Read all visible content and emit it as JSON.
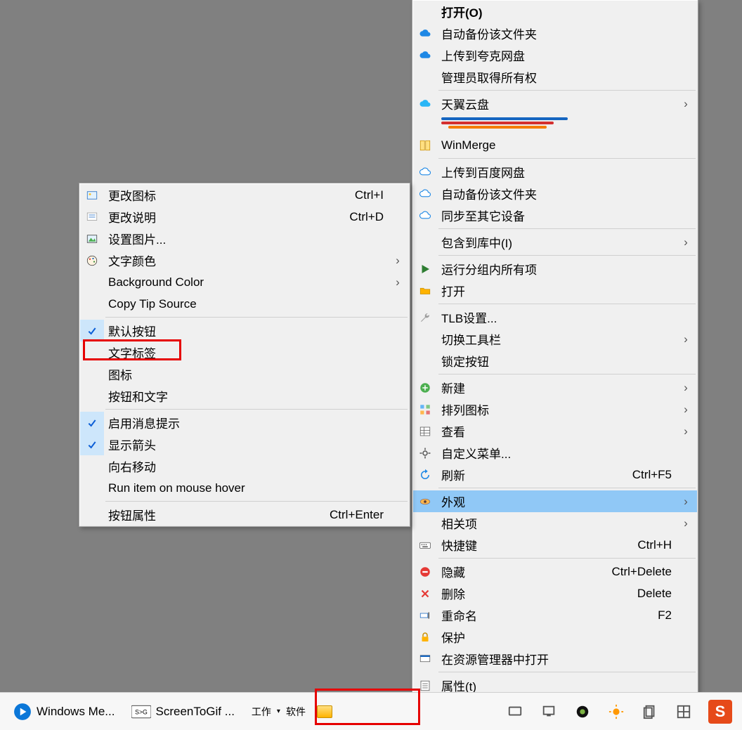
{
  "submenu": {
    "items": [
      {
        "icon": "picture-icon",
        "label": "更改图标",
        "shortcut": "Ctrl+I"
      },
      {
        "icon": "edit-icon",
        "label": "更改说明",
        "shortcut": "Ctrl+D"
      },
      {
        "icon": "image-icon",
        "label": "设置图片..."
      },
      {
        "icon": "palette-icon",
        "label": "文字颜色",
        "submenu": true
      },
      {
        "label": "Background Color",
        "submenu": true
      },
      {
        "label": "Copy Tip Source"
      },
      {
        "sep": true
      },
      {
        "checked": true,
        "label": "默认按钮"
      },
      {
        "label": "文字标签"
      },
      {
        "label": "图标"
      },
      {
        "label": "按钮和文字"
      },
      {
        "sep": true
      },
      {
        "checked": true,
        "label": "启用消息提示"
      },
      {
        "checked": true,
        "label": "显示箭头"
      },
      {
        "label": "向右移动"
      },
      {
        "label": "Run item on mouse hover"
      },
      {
        "sep": true
      },
      {
        "label": "按钮属性",
        "shortcut": "Ctrl+Enter"
      }
    ]
  },
  "menu": {
    "items": [
      {
        "bold": true,
        "label": "打开(O)"
      },
      {
        "icon": "cloud-blue-icon",
        "label": "自动备份该文件夹"
      },
      {
        "icon": "cloud-blue-icon",
        "label": "上传到夸克网盘"
      },
      {
        "label": "管理员取得所有权"
      },
      {
        "sep": true
      },
      {
        "icon": "cloud-sky-icon",
        "label": "天翼云盘",
        "submenu": true
      },
      {
        "pencils": true
      },
      {
        "icon": "winmerge-icon",
        "label": "WinMerge"
      },
      {
        "sep": true
      },
      {
        "icon": "baidu-cloud-icon",
        "label": "上传到百度网盘"
      },
      {
        "icon": "baidu-cloud-icon",
        "label": "自动备份该文件夹"
      },
      {
        "icon": "baidu-cloud-icon",
        "label": "同步至其它设备"
      },
      {
        "sep": true
      },
      {
        "label": "包含到库中(I)",
        "submenu": true
      },
      {
        "sep": true
      },
      {
        "icon": "play-green-icon",
        "label": "运行分组内所有项"
      },
      {
        "icon": "folder-open-icon",
        "label": "打开"
      },
      {
        "sep": true
      },
      {
        "icon": "wrench-icon",
        "label": "TLB设置..."
      },
      {
        "label": "切换工具栏",
        "submenu": true
      },
      {
        "label": "锁定按钮"
      },
      {
        "sep": true
      },
      {
        "icon": "plus-green-icon",
        "label": "新建",
        "submenu": true
      },
      {
        "icon": "arrange-icon",
        "label": "排列图标",
        "submenu": true
      },
      {
        "icon": "grid-icon",
        "label": "查看",
        "submenu": true
      },
      {
        "icon": "gear-icon",
        "label": "自定义菜单..."
      },
      {
        "icon": "refresh-icon",
        "label": "刷新",
        "shortcut": "Ctrl+F5"
      },
      {
        "sep": true
      },
      {
        "icon": "eye-icon",
        "highlighted": true,
        "label": "外观",
        "submenu": true
      },
      {
        "label": "相关项",
        "submenu": true
      },
      {
        "icon": "keyboard-icon",
        "label": "快捷键",
        "shortcut": "Ctrl+H"
      },
      {
        "sep": true
      },
      {
        "icon": "minus-red-icon",
        "label": "隐藏",
        "shortcut": "Ctrl+Delete"
      },
      {
        "icon": "delete-red-icon",
        "label": "删除",
        "shortcut": "Delete"
      },
      {
        "icon": "rename-icon",
        "label": "重命名",
        "shortcut": "F2"
      },
      {
        "icon": "lock-icon",
        "label": "保护"
      },
      {
        "icon": "explorer-icon",
        "label": "在资源管理器中打开"
      },
      {
        "sep": true
      },
      {
        "icon": "properties-icon",
        "label": "属性(t)"
      }
    ]
  },
  "taskbar": {
    "items": [
      {
        "icon": "wmp-icon",
        "label": "Windows Me..."
      },
      {
        "icon": "screentogif-icon",
        "label": "ScreenToGif ..."
      }
    ],
    "mini": {
      "label1": "工作",
      "label2": "软件"
    },
    "ime": "S"
  }
}
